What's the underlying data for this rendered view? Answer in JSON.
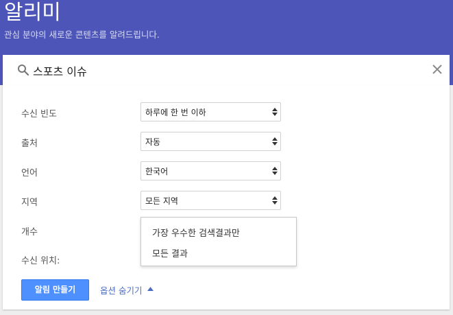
{
  "header": {
    "title": "알리미",
    "subtitle": "관심 분야의 새로운 콘텐츠를 알려드립니다."
  },
  "search": {
    "query": "스포츠 이슈"
  },
  "options": {
    "frequency": {
      "label": "수신 빈도",
      "value": "하루에 한 번 이하"
    },
    "sources": {
      "label": "출처",
      "value": "자동"
    },
    "language": {
      "label": "언어",
      "value": "한국어"
    },
    "region": {
      "label": "지역",
      "value": "모든 지역"
    },
    "how_many": {
      "label": "개수"
    },
    "deliver_to": {
      "label": "수신 위치:"
    }
  },
  "dropdown": {
    "items": [
      "가장 우수한 검색결과만",
      "모든 결과"
    ]
  },
  "actions": {
    "create_label": "알림 만들기",
    "hide_options_label": "옵션 숨기기"
  },
  "colors": {
    "header_bg": "#4d56b8",
    "button_bg": "#4d90fe",
    "link": "#4d6ebf"
  }
}
